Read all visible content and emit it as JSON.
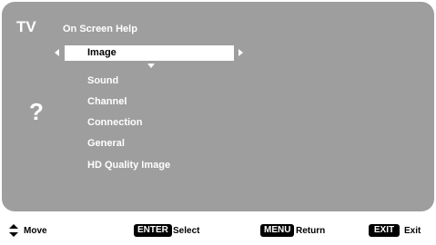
{
  "header": {
    "tv_label": "TV",
    "title": "On Screen Help"
  },
  "menu": {
    "items": [
      {
        "label": "Image",
        "selected": true
      },
      {
        "label": "Sound",
        "selected": false
      },
      {
        "label": "Channel",
        "selected": false
      },
      {
        "label": "Connection",
        "selected": false
      },
      {
        "label": "General",
        "selected": false
      },
      {
        "label": "HD Quality Image",
        "selected": false
      }
    ]
  },
  "help_icon": "?",
  "footer": {
    "move_icon": "up-down-arrow-icon",
    "move_label": "Move",
    "enter_key": "ENTER",
    "select_label": "Select",
    "menu_key": "MENU",
    "return_label": "Return",
    "exit_key": "EXIT",
    "exit_label": "Exit"
  },
  "colors": {
    "panel": "#8f8f8f",
    "text": "#ffffff",
    "highlight": "#ffffff",
    "key_bg": "#000000"
  }
}
